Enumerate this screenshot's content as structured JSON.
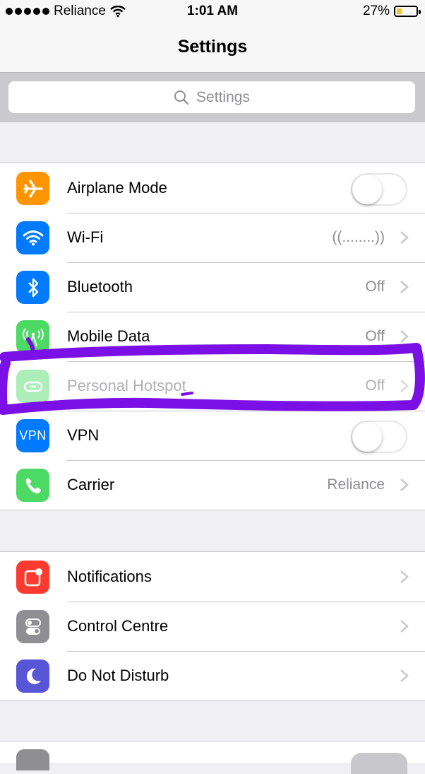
{
  "status_bar": {
    "carrier": "Reliance",
    "time": "1:01 AM",
    "battery_percent": "27%",
    "battery_level": 0.27
  },
  "nav": {
    "title": "Settings"
  },
  "search": {
    "placeholder": "Settings"
  },
  "connectivity": [
    {
      "id": "airplane",
      "label": "Airplane Mode",
      "icon": "airplane-icon",
      "color": "#ff9500",
      "toggle": false
    },
    {
      "id": "wifi",
      "label": "Wi-Fi",
      "icon": "wifi-icon",
      "color": "#007aff",
      "value": "((........))"
    },
    {
      "id": "bluetooth",
      "label": "Bluetooth",
      "icon": "bluetooth-icon",
      "color": "#007aff",
      "value": "Off"
    },
    {
      "id": "mobile-data",
      "label": "Mobile Data",
      "icon": "antenna-icon",
      "color": "#4cd964",
      "value": "Off"
    },
    {
      "id": "hotspot",
      "label": "Personal Hotspot",
      "icon": "hotspot-icon",
      "color": "#4cd964",
      "value": "Off",
      "disabled": true
    },
    {
      "id": "vpn",
      "label": "VPN",
      "icon": "vpn-icon",
      "icon_text": "VPN",
      "color": "#007aff",
      "toggle": false
    },
    {
      "id": "carrier",
      "label": "Carrier",
      "icon": "phone-icon",
      "color": "#4cd964",
      "value": "Reliance"
    }
  ],
  "system": [
    {
      "id": "notifications",
      "label": "Notifications",
      "icon": "notifications-icon",
      "color": "#ff3b30"
    },
    {
      "id": "control-centre",
      "label": "Control Centre",
      "icon": "switches-icon",
      "color": "#8e8e93"
    },
    {
      "id": "do-not-disturb",
      "label": "Do Not Disturb",
      "icon": "moon-icon",
      "color": "#5856d6"
    }
  ],
  "annotation": {
    "color": "#7a10e6"
  }
}
